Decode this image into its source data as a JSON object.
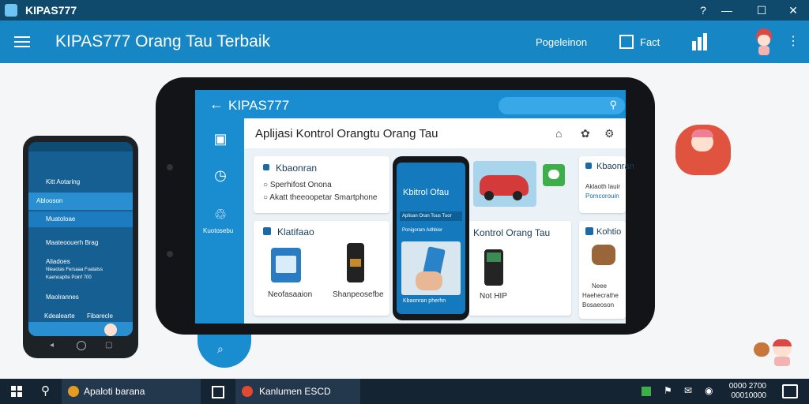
{
  "window": {
    "title": "KIPAS777",
    "controls": [
      "?",
      "—",
      "☐",
      "✕"
    ]
  },
  "header": {
    "app_title": "KIPAS777 Orang Tau Terbaik",
    "nav": [
      {
        "label": "Pogeleinon",
        "icon": "none"
      },
      {
        "label": "Fact",
        "icon": "cube-icon"
      }
    ]
  },
  "tablet": {
    "brand": "KIPAS777",
    "panel_title": "Aplijasi Kontrol Orangtu Orang Tau",
    "side_label": "Kuotosebu",
    "card1": {
      "title": "Kbaonran",
      "items": [
        "Sperhifost Onona",
        "Akatt theeoopetar Smartphone"
      ]
    },
    "card_right1": {
      "title": "Kbaonran",
      "lines": [
        "Aklaoth lauir",
        "Pomcorouin"
      ]
    },
    "card2": {
      "title": "Klatifaao",
      "items": [
        "Neofasaaion",
        "Shanpeosefbe"
      ]
    },
    "card3": {
      "title": "Kontrol Orang Tau",
      "item": "Not HIP"
    },
    "card_right2": {
      "title": "Kohtio",
      "lines": [
        "Neee",
        "Haehecrathe",
        "Bosaeoson"
      ]
    },
    "inner_phone": {
      "title": "Kbitrol Ofau",
      "rows": [
        "Aplisan Oran Tous Tuor",
        "Ponigoram Adhbier"
      ],
      "caption": "Kbaonran pherhn"
    }
  },
  "left_phone": {
    "rows": [
      "Kitt Aotaring",
      "Ablooson",
      "Muatoloae",
      "Maateoouerh Brag",
      "Aliadoes",
      "Nleaotas Fersaaa Fuatatss",
      "Kaenoaptte Poinf 700",
      "Maolrannes",
      "Kdealearte",
      "Fibarecle"
    ]
  },
  "taskbar": {
    "app1": "Apaloti barana",
    "app2": "Kanlumen ESCD",
    "time": "0000 2700",
    "date": "00010000"
  }
}
